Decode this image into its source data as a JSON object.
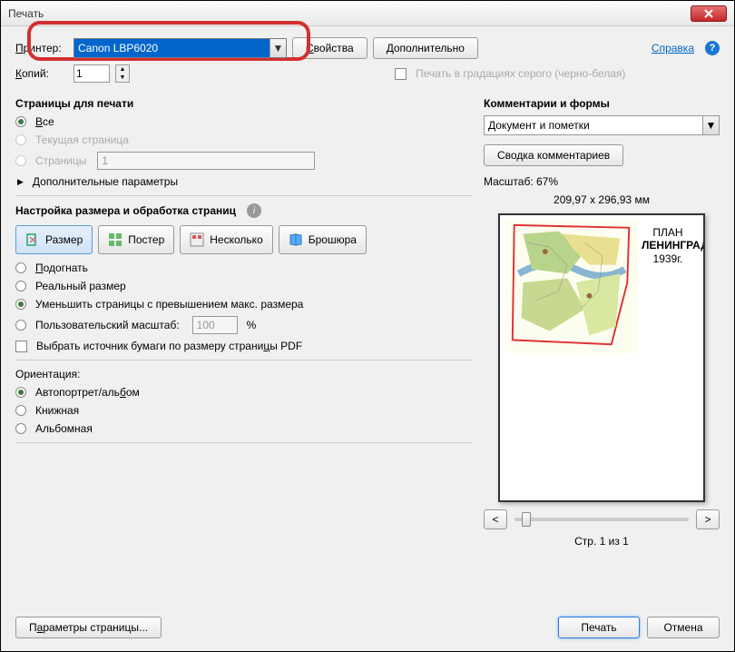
{
  "title": "Печать",
  "printer": {
    "label": "Принтер:",
    "selected": "Canon LBP6020"
  },
  "buttons": {
    "properties": "Свойства",
    "advanced": "Дополнительно",
    "help": "Справка",
    "page_setup": "Параметры страницы...",
    "print": "Печать",
    "cancel": "Отмена",
    "comments_summary": "Сводка комментариев"
  },
  "copies": {
    "label": "Копий:",
    "value": "1"
  },
  "grayscale": "Печать в градациях серого (черно-белая)",
  "pages": {
    "title": "Страницы для печати",
    "all": "Все",
    "current": "Текущая страница",
    "range_label": "Страницы",
    "range_value": "1",
    "more": "Дополнительные параметры"
  },
  "sizing": {
    "title": "Настройка размера и обработка страниц",
    "size": "Размер",
    "poster": "Постер",
    "multiple": "Несколько",
    "booklet": "Брошюра",
    "fit": "Подогнать",
    "actual": "Реальный размер",
    "shrink": "Уменьшить страницы с превышением макс. размера",
    "custom": "Пользовательский масштаб:",
    "custom_val": "100",
    "pct": "%",
    "source": "Выбрать источник бумаги по размеру страницы PDF"
  },
  "orientation": {
    "title": "Ориентация:",
    "auto": "Автопортрет/альбом",
    "portrait": "Книжная",
    "landscape": "Альбомная"
  },
  "comments": {
    "title": "Комментарии и формы",
    "selected": "Документ и пометки"
  },
  "preview": {
    "scale_label": "Масштаб: 67%",
    "dims": "209,97 x 296,93 мм",
    "map_title1": "ПЛАН",
    "map_title2": "ЛЕНИНГРАДА",
    "map_title3": "1939г.",
    "page_info": "Стр. 1 из 1",
    "prev": "<",
    "next": ">"
  }
}
